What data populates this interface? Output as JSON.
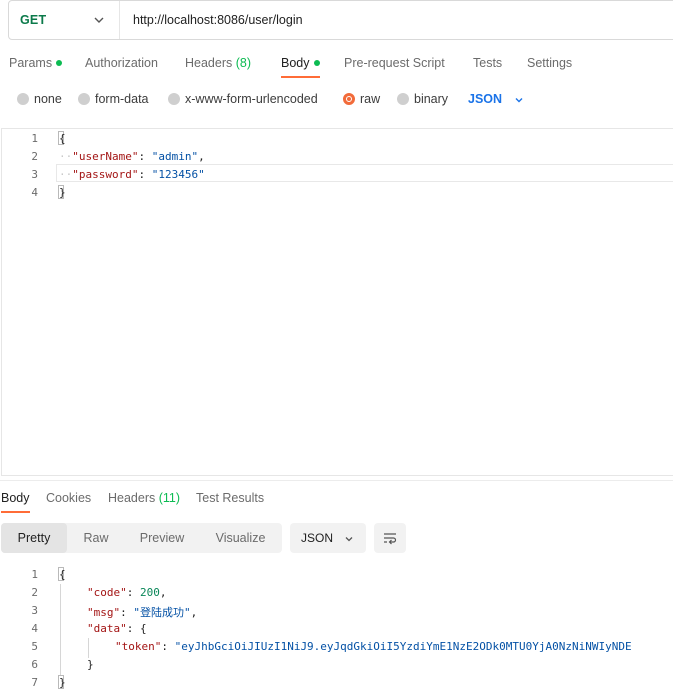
{
  "request": {
    "method": "GET",
    "url": "http://localhost:8086/user/login"
  },
  "request_tabs": {
    "params": "Params",
    "authorization": "Authorization",
    "headers": "Headers",
    "headers_count": "(8)",
    "body": "Body",
    "pre_request": "Pre-request Script",
    "tests": "Tests",
    "settings": "Settings"
  },
  "body_types": {
    "none": "none",
    "form_data": "form-data",
    "urlencoded": "x-www-form-urlencoded",
    "raw": "raw",
    "binary": "binary",
    "selected": "raw",
    "language": "JSON"
  },
  "request_editor": {
    "line_numbers": [
      "1",
      "2",
      "3",
      "4"
    ],
    "open": "{",
    "close": "}",
    "username_key": "\"userName\"",
    "username_value": "\"admin\"",
    "password_key": "\"password\"",
    "password_value": "\"123456\""
  },
  "response_tabs": {
    "body": "Body",
    "cookies": "Cookies",
    "headers": "Headers",
    "headers_count": "(11)",
    "test_results": "Test Results"
  },
  "view_modes": {
    "pretty": "Pretty",
    "raw": "Raw",
    "preview": "Preview",
    "visualize": "Visualize",
    "format": "JSON"
  },
  "response_editor": {
    "line_numbers": [
      "1",
      "2",
      "3",
      "4",
      "5",
      "6",
      "7"
    ],
    "open": "{",
    "close": "}",
    "code_key": "\"code\"",
    "code_value": "200",
    "msg_key": "\"msg\"",
    "msg_value": "\"登陆成功\"",
    "data_key": "\"data\"",
    "token_key": "\"token\"",
    "token_value": "\"eyJhbGciOiJIUzI1NiJ9.eyJqdGkiOiI5YzdiYmE1NzE2ODk0MTU0YjA0NzNiNWIyNDE"
  },
  "colors": {
    "accent_orange": "#ff6c37",
    "status_green": "#0cbb52",
    "method_green": "#0b7a4a",
    "link_blue": "#1a73e8"
  }
}
